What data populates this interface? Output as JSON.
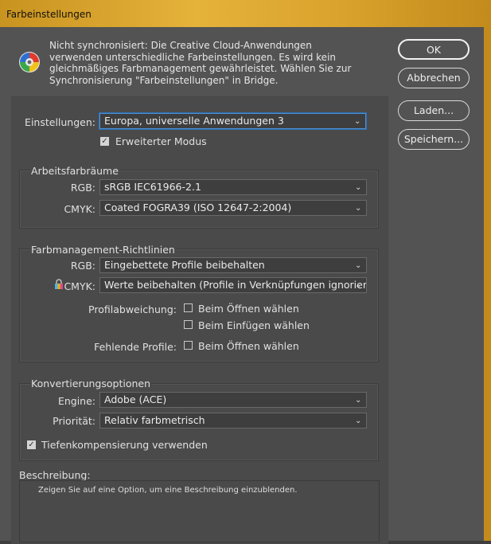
{
  "window": {
    "title": "Farbeinstellungen"
  },
  "sync": {
    "icon": "color-wheel-icon",
    "message": "Nicht synchronisiert: Die Creative Cloud-Anwendungen verwenden unterschiedliche Farbeinstellungen. Es wird kein gleichmäßiges Farbmanagement gewährleistet. Wählen Sie zur Synchronisierung \"Farbeinstellungen\" in Bridge."
  },
  "buttons": {
    "ok": "OK",
    "cancel": "Abbrechen",
    "load": "Laden...",
    "save": "Speichern..."
  },
  "settings": {
    "label": "Einstellungen:",
    "value": "Europa, universelle Anwendungen 3",
    "advanced_mode": {
      "label": "Erweiterter Modus",
      "checked": true
    }
  },
  "working_spaces": {
    "title": "Arbeitsfarbräume",
    "rgb_label": "RGB:",
    "rgb_value": "sRGB IEC61966-2.1",
    "cmyk_label": "CMYK:",
    "cmyk_value": "Coated FOGRA39 (ISO 12647-2:2004)"
  },
  "policies": {
    "title": "Farbmanagement-Richtlinien",
    "rgb_label": "RGB:",
    "rgb_value": "Eingebettete Profile beibehalten",
    "cmyk_label": "CMYK:",
    "cmyk_value": "Werte beibehalten (Profile in Verknüpfungen ignorier...",
    "profile_mismatch_label": "Profilabweichung:",
    "mismatch_open": {
      "label": "Beim Öffnen wählen",
      "checked": false
    },
    "mismatch_paste": {
      "label": "Beim Einfügen wählen",
      "checked": false
    },
    "missing_profiles_label": "Fehlende Profile:",
    "missing_open": {
      "label": "Beim Öffnen wählen",
      "checked": false
    }
  },
  "conversion": {
    "title": "Konvertierungsoptionen",
    "engine_label": "Engine:",
    "engine_value": "Adobe (ACE)",
    "intent_label": "Priorität:",
    "intent_value": "Relativ farbmetrisch",
    "black_point": {
      "label": "Tiefenkompensierung verwenden",
      "checked": true
    }
  },
  "description": {
    "label": "Beschreibung:",
    "text": "Zeigen Sie auf eine Option, um eine Beschreibung einzublenden."
  },
  "colors": {
    "titlebar": "#d9a22c",
    "dialog_bg": "#535353",
    "focus": "#4a90d9"
  }
}
